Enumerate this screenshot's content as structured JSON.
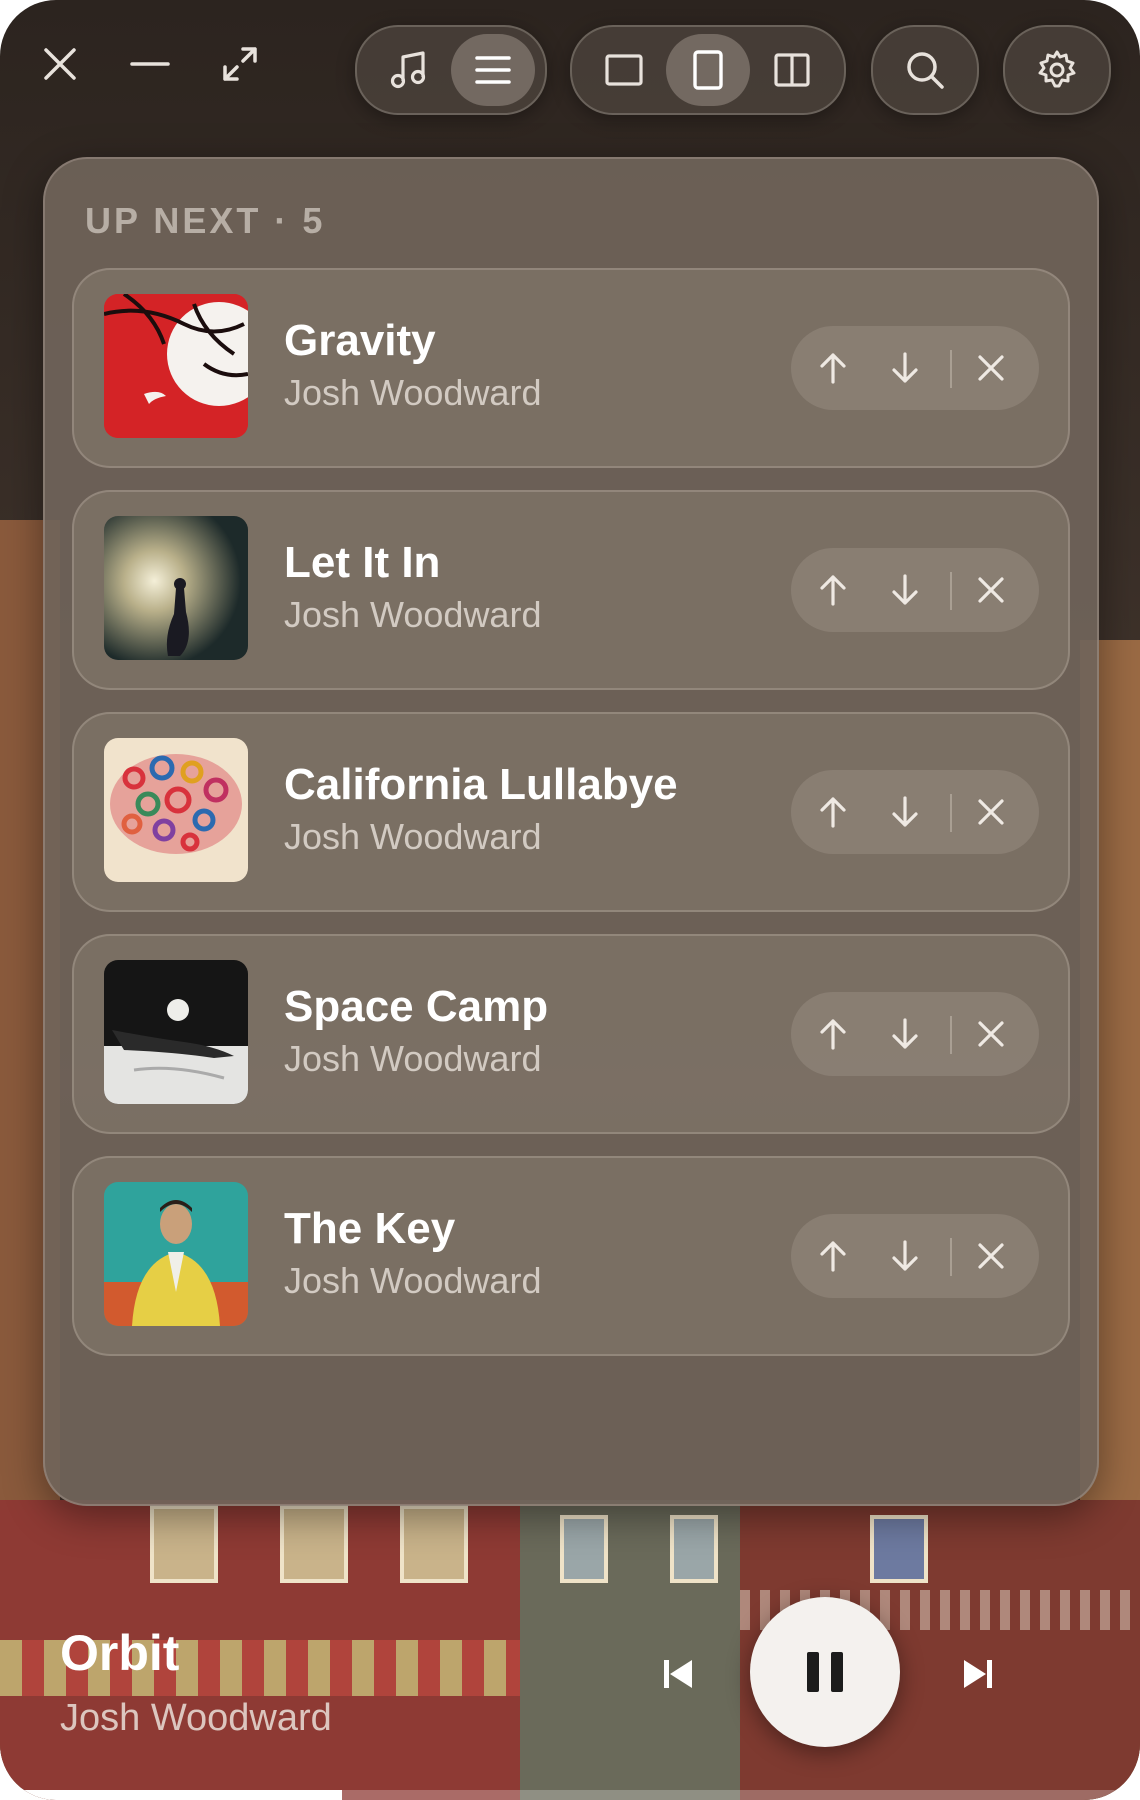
{
  "window": {
    "close_icon": "close-icon",
    "minimize_icon": "minimize-icon",
    "expand_icon": "expand-icon"
  },
  "toolbar": {
    "view_group": [
      "music-note-icon",
      "queue-list-icon"
    ],
    "active_view": "queue-list-icon",
    "layout_group": [
      "layout-square-icon",
      "layout-portrait-icon",
      "layout-columns-icon"
    ],
    "active_layout": "layout-portrait-icon",
    "search_icon": "search-icon",
    "settings_icon": "gear-icon"
  },
  "queue": {
    "title": "UP NEXT · 5",
    "items": [
      {
        "title": "Gravity",
        "artist": "Josh Woodward",
        "cover": "red-tree-moon"
      },
      {
        "title": "Let It In",
        "artist": "Josh Woodward",
        "cover": "figure-in-light"
      },
      {
        "title": "California Lullabye",
        "artist": "Josh Woodward",
        "cover": "flower-cloud"
      },
      {
        "title": "Space Camp",
        "artist": "Josh Woodward",
        "cover": "moon-shipwreck"
      },
      {
        "title": "The Key",
        "artist": "Josh Woodward",
        "cover": "man-yellow-jacket"
      }
    ]
  },
  "now_playing": {
    "title": "Orbit",
    "artist": "Josh Woodward",
    "progress": 0.3,
    "state": "playing"
  },
  "colors": {
    "panel": "#706458",
    "text_primary": "#ffffff",
    "play_button": "#f4f1ee"
  }
}
